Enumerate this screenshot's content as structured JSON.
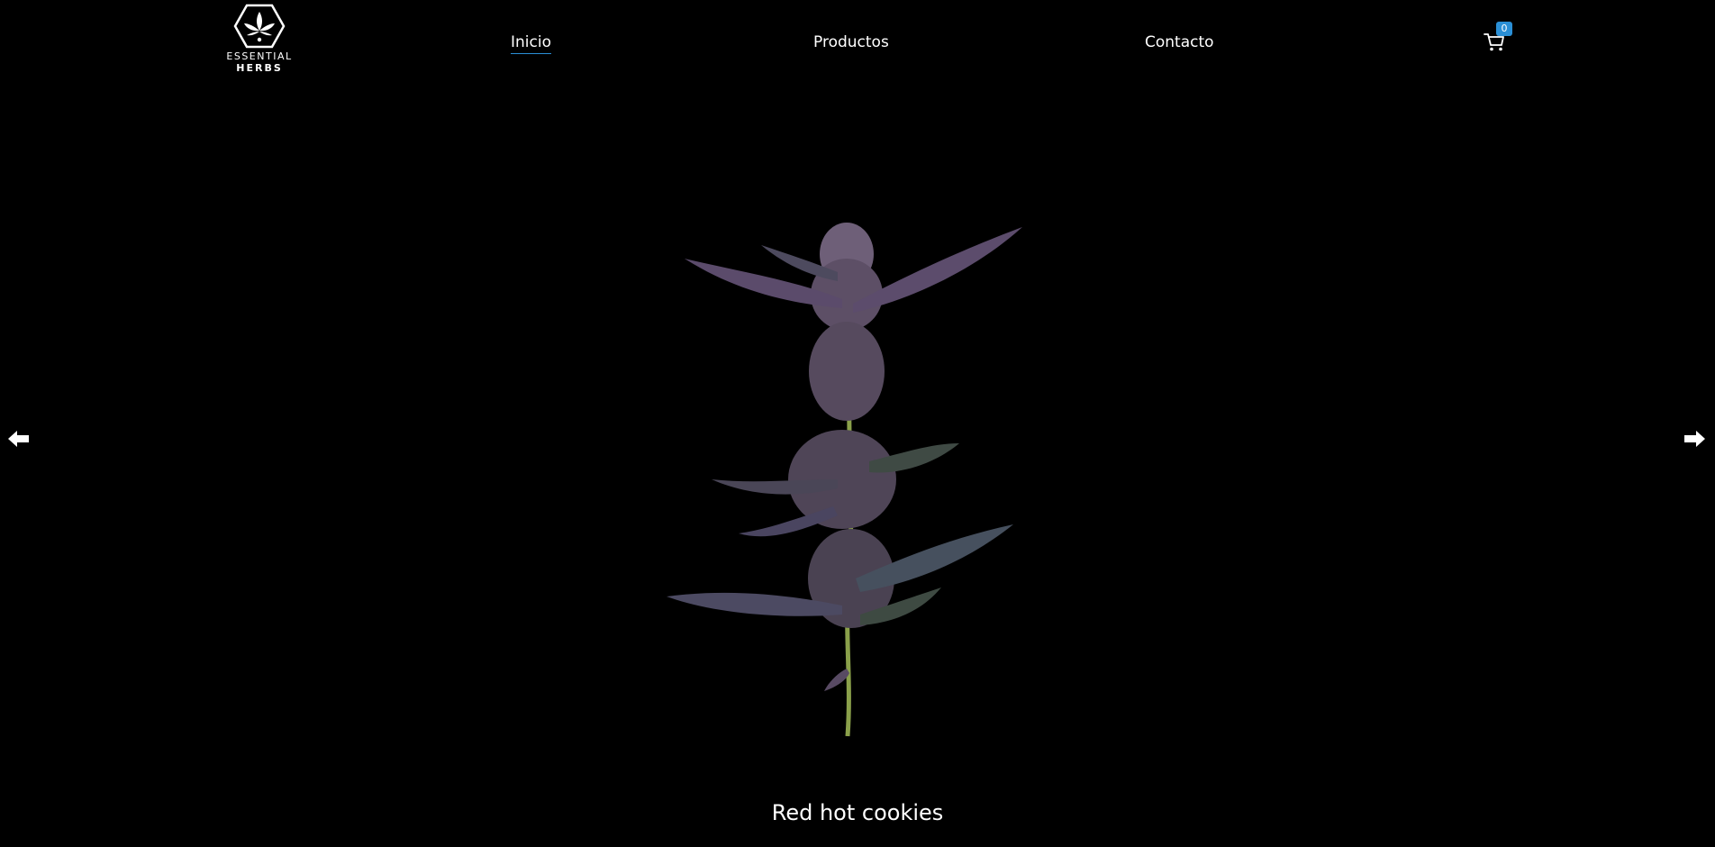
{
  "header": {
    "logo": {
      "line1": "ESSENTIAL",
      "line2": "HERBS",
      "icon": "hexagon-leaf-icon"
    },
    "nav": [
      {
        "label": "Inicio",
        "active": true
      },
      {
        "label": "Productos",
        "active": false
      },
      {
        "label": "Contacto",
        "active": false
      }
    ],
    "cart": {
      "icon": "cart-icon",
      "count": "0"
    }
  },
  "carousel": {
    "prev_icon": "arrow-left-icon",
    "next_icon": "arrow-right-icon",
    "slide_caption": "Red hot cookies"
  },
  "colors": {
    "background": "#000000",
    "text": "#ffffff",
    "accent": "#2a8fd6"
  }
}
